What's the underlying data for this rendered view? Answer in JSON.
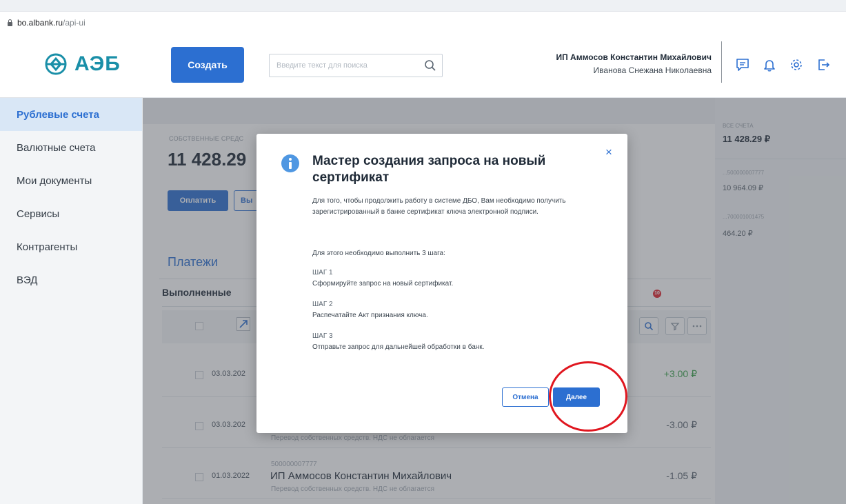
{
  "browser": {
    "url_host": "bo.albank.ru",
    "url_path": "/api-ui"
  },
  "header": {
    "logo_text": "АЭБ",
    "create_label": "Создать",
    "search_placeholder": "Введите текст для поиска",
    "org_name": "ИП Аммосов Константин Михайлович",
    "user_name": "Иванова Снежана Николаевна",
    "icons": [
      "chat-icon",
      "bell-icon",
      "gear-icon",
      "logout-icon"
    ]
  },
  "sidebar": {
    "items": [
      {
        "label": "Рублевые счета",
        "active": true
      },
      {
        "label": "Валютные счета",
        "active": false
      },
      {
        "label": "Мои документы",
        "active": false
      },
      {
        "label": "Сервисы",
        "active": false
      },
      {
        "label": "Контрагенты",
        "active": false
      },
      {
        "label": "ВЭД",
        "active": false
      }
    ]
  },
  "main": {
    "own_funds_label": "СОБСТВЕННЫЕ СРЕДС",
    "own_funds_amount": "11 428.29",
    "pay_label": "Оплатить",
    "out_label": "Вы",
    "payments_title": "Платежи",
    "tab_done": "Выполненные",
    "tab_badge": "10",
    "rows": [
      {
        "date": "03.03.202",
        "account": "",
        "party": "",
        "purpose": "",
        "amount": "+3.00 ₽",
        "sign": "pos"
      },
      {
        "date": "03.03.202",
        "account": "",
        "party": "",
        "purpose": "Перевод собственных средств. НДС не облагается",
        "amount": "-3.00 ₽",
        "sign": "neg"
      },
      {
        "date": "01.03.2022",
        "account": "500000007777",
        "party": "ИП Аммосов Константин Михайлович",
        "purpose": "Перевод собственных средств. НДС не облагается",
        "amount": "-1.05 ₽",
        "sign": "neg"
      }
    ]
  },
  "right_panel": {
    "all_label": "ВСЕ СЧЕТА",
    "all_total": "11 428.29 ₽",
    "accounts": [
      {
        "number": "...500000007777",
        "balance": "10 964.09 ₽"
      },
      {
        "number": "...700001001475",
        "balance": "464.20 ₽"
      }
    ]
  },
  "modal": {
    "title": "Мастер создания запроса на новый сертификат",
    "intro": "Для того, чтобы продолжить работу в системе ДБО, Вам необходимо получить зарегистрированный в банке сертификат ключа электронной подписи.",
    "steps_intro": "Для этого необходимо выполнить 3 шага:",
    "steps": [
      {
        "label": "ШАГ 1",
        "text": "Сформируйте запрос на новый сертификат."
      },
      {
        "label": "ШАГ 2",
        "text": "Распечатайте Акт признания ключа."
      },
      {
        "label": "ШАГ 3",
        "text": "Отправьте запрос для дальнейшей обработки в банк."
      }
    ],
    "cancel_label": "Отмена",
    "next_label": "Далее",
    "close_glyph": "×"
  },
  "colors": {
    "accent": "#2c6fd1",
    "logo": "#1a8fa8",
    "positive": "#3aa24a",
    "badge": "#e0262f",
    "annotation": "#e0161f"
  }
}
